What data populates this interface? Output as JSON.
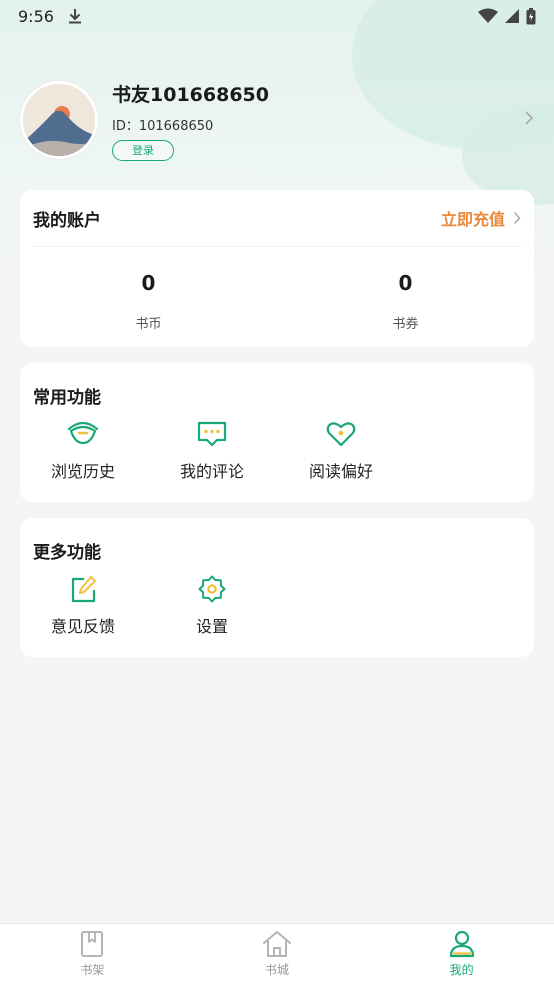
{
  "status_bar": {
    "time": "9:56"
  },
  "profile": {
    "username": "书友101668650",
    "user_id": "ID：101668650",
    "login_label": "登录"
  },
  "account": {
    "title": "我的账户",
    "recharge_label": "立即充值",
    "stats": [
      {
        "value": "0",
        "label": "书币"
      },
      {
        "value": "0",
        "label": "书券"
      }
    ]
  },
  "common_functions": {
    "title": "常用功能",
    "items": [
      {
        "label": "浏览历史",
        "icon": "eye-icon"
      },
      {
        "label": "我的评论",
        "icon": "comment-icon"
      },
      {
        "label": "阅读偏好",
        "icon": "heart-icon"
      }
    ]
  },
  "more_functions": {
    "title": "更多功能",
    "items": [
      {
        "label": "意见反馈",
        "icon": "edit-icon"
      },
      {
        "label": "设置",
        "icon": "gear-icon"
      }
    ]
  },
  "bottom_nav": {
    "items": [
      {
        "label": "书架",
        "icon": "bookshelf-icon",
        "active": false
      },
      {
        "label": "书城",
        "icon": "home-icon",
        "active": false
      },
      {
        "label": "我的",
        "icon": "profile-icon",
        "active": true
      }
    ]
  },
  "colors": {
    "accent": "#1aa876",
    "recharge": "#e8893c",
    "background": "#f5f5f5"
  }
}
